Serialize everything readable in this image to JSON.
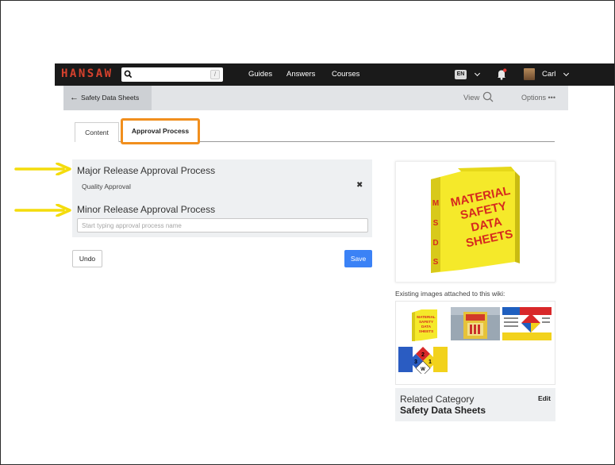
{
  "app": {
    "brand": "HANSAW",
    "brand_color": "#d6412d",
    "accent_color": "#3b82f6",
    "highlight_color": "#f18f1e",
    "annotation_arrow_color": "#f4dc0c"
  },
  "navbar": {
    "search_shortcut": "/",
    "links": [
      "Guides",
      "Answers",
      "Courses"
    ],
    "language": "EN",
    "user_name": "Carl"
  },
  "subbar": {
    "back_label": "Safety Data Sheets",
    "view_label": "View",
    "options_label": "Options •••"
  },
  "tabs": [
    {
      "label": "Content",
      "active": false
    },
    {
      "label": "Approval Process",
      "active": true
    }
  ],
  "approval": {
    "major_heading": "Major Release Approval Process",
    "major_selected": "Quality Approval",
    "remove_symbol": "✖",
    "minor_heading": "Minor Release Approval Process",
    "minor_placeholder": "Start typing approval process name"
  },
  "actions": {
    "undo_label": "Undo",
    "save_label": "Save"
  },
  "main_image": {
    "binder_text": [
      "MATERIAL",
      "SAFETY",
      "DATA",
      "SHEETS"
    ],
    "spine_letters": [
      "M",
      "S",
      "D",
      "S"
    ]
  },
  "images": {
    "existing_label": "Existing images attached to this wiki:",
    "thumb_binder_text": [
      "MATERIAL",
      "SAFETY",
      "DATA",
      "SHEETS"
    ],
    "diamond_numbers": [
      "2",
      "3",
      "1",
      "W"
    ]
  },
  "related": {
    "label": "Related Category",
    "value": "Safety Data Sheets",
    "edit_label": "Edit"
  }
}
